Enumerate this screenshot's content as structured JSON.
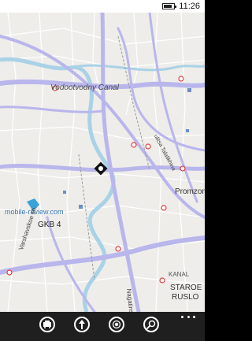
{
  "status_bar": {
    "time": "11:26",
    "icons": [
      "battery-icon"
    ]
  },
  "map": {
    "labels": {
      "canal": "Vodootvodny Canal",
      "taldomskaya": "ulitsa Talalikhina",
      "promzona": "Promzon",
      "watermark": "mobile-review.com",
      "gkb": "GKB 4",
      "varshavskoe": "Varshavskoe sh.",
      "nagatinskaya": "Nagatinskaya",
      "kanal": "KANAL",
      "staroe": "STAROE",
      "ruslo": "RUSLO"
    },
    "metro_icon": "metro-station-icon",
    "location_icon": "current-location-icon",
    "colors": {
      "land": "#ebe9e6",
      "water": "#a9d2e6",
      "road_major": "#b9b6ec",
      "road_minor": "#ffffff",
      "metro": "#e23a3a"
    }
  },
  "app_bar": {
    "buttons": [
      {
        "name": "transit",
        "icon": "transit-icon"
      },
      {
        "name": "directions",
        "icon": "directions-icon"
      },
      {
        "name": "me",
        "icon": "location-target-icon"
      },
      {
        "name": "search",
        "icon": "search-icon"
      }
    ],
    "more_icon": "more-dots-icon"
  }
}
